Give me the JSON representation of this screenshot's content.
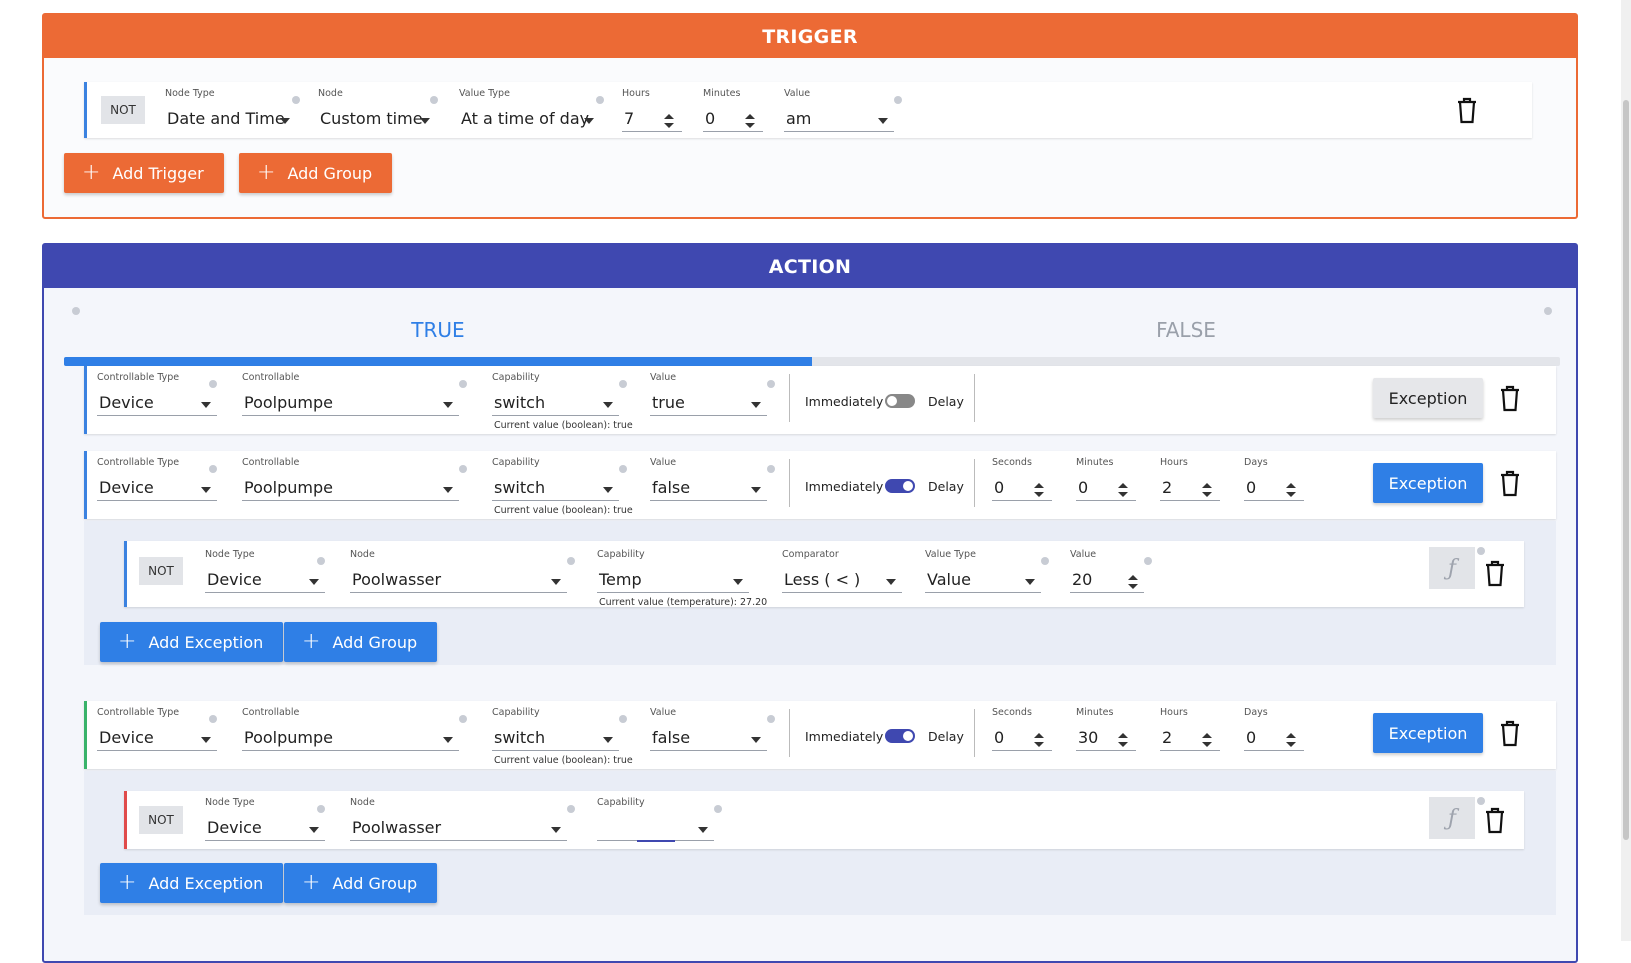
{
  "trigger": {
    "title": "TRIGGER",
    "row": {
      "not": "NOT",
      "node_type": {
        "label": "Node Type",
        "value": "Date and Time"
      },
      "node": {
        "label": "Node",
        "value": "Custom time"
      },
      "value_type": {
        "label": "Value Type",
        "value": "At a time of day"
      },
      "hours": {
        "label": "Hours",
        "value": "7"
      },
      "minutes": {
        "label": "Minutes",
        "value": "0"
      },
      "value": {
        "label": "Value",
        "value": "am"
      }
    },
    "add_trigger": "Add Trigger",
    "add_group": "Add Group"
  },
  "action": {
    "title": "ACTION",
    "tabs": {
      "true": "TRUE",
      "false": "FALSE",
      "active": "true"
    },
    "rows": [
      {
        "controllable_type": {
          "label": "Controllable Type",
          "value": "Device"
        },
        "controllable": {
          "label": "Controllable",
          "value": "Poolpumpe"
        },
        "capability": {
          "label": "Capability",
          "value": "switch",
          "hint": "Current value (boolean): true"
        },
        "value": {
          "label": "Value",
          "value": "true"
        },
        "immediately": "Immediately",
        "delay": "Delay",
        "delay_on": false,
        "exception": "Exception"
      },
      {
        "controllable_type": {
          "label": "Controllable Type",
          "value": "Device"
        },
        "controllable": {
          "label": "Controllable",
          "value": "Poolpumpe"
        },
        "capability": {
          "label": "Capability",
          "value": "switch",
          "hint": "Current value (boolean): true"
        },
        "value": {
          "label": "Value",
          "value": "false"
        },
        "immediately": "Immediately",
        "delay": "Delay",
        "delay_on": true,
        "seconds": {
          "label": "Seconds",
          "value": "0"
        },
        "minutes": {
          "label": "Minutes",
          "value": "0"
        },
        "hours": {
          "label": "Hours",
          "value": "2"
        },
        "days": {
          "label": "Days",
          "value": "0"
        },
        "exception": "Exception",
        "exception_row": {
          "not": "NOT",
          "node_type": {
            "label": "Node Type",
            "value": "Device"
          },
          "node": {
            "label": "Node",
            "value": "Poolwasser"
          },
          "capability": {
            "label": "Capability",
            "value": "Temp",
            "hint": "Current value (temperature): 27.20"
          },
          "comparator": {
            "label": "Comparator",
            "value": "Less ( < )"
          },
          "value_type": {
            "label": "Value Type",
            "value": "Value"
          },
          "value": {
            "label": "Value",
            "value": "20"
          },
          "fx": "ƒ"
        },
        "add_exception": "Add Exception",
        "add_group": "Add Group"
      },
      {
        "controllable_type": {
          "label": "Controllable Type",
          "value": "Device"
        },
        "controllable": {
          "label": "Controllable",
          "value": "Poolpumpe"
        },
        "capability": {
          "label": "Capability",
          "value": "switch",
          "hint": "Current value (boolean): true"
        },
        "value": {
          "label": "Value",
          "value": "false"
        },
        "immediately": "Immediately",
        "delay": "Delay",
        "delay_on": true,
        "seconds": {
          "label": "Seconds",
          "value": "0"
        },
        "minutes": {
          "label": "Minutes",
          "value": "30"
        },
        "hours": {
          "label": "Hours",
          "value": "2"
        },
        "days": {
          "label": "Days",
          "value": "0"
        },
        "exception": "Exception",
        "exception_row": {
          "not": "NOT",
          "node_type": {
            "label": "Node Type",
            "value": "Device"
          },
          "node": {
            "label": "Node",
            "value": "Poolwasser"
          },
          "capability": {
            "label": "Capability",
            "value": ""
          },
          "fx": "ƒ"
        },
        "add_exception": "Add Exception",
        "add_group": "Add Group"
      }
    ]
  },
  "icons": {
    "trash": "trash-icon",
    "plus": "plus-icon",
    "info": "info-icon",
    "caret": "caret-down-icon",
    "spinner": "spinner-icon"
  },
  "colors": {
    "trigger": "#ec6a35",
    "action": "#3f48b0",
    "primary": "#2f7fe6"
  }
}
